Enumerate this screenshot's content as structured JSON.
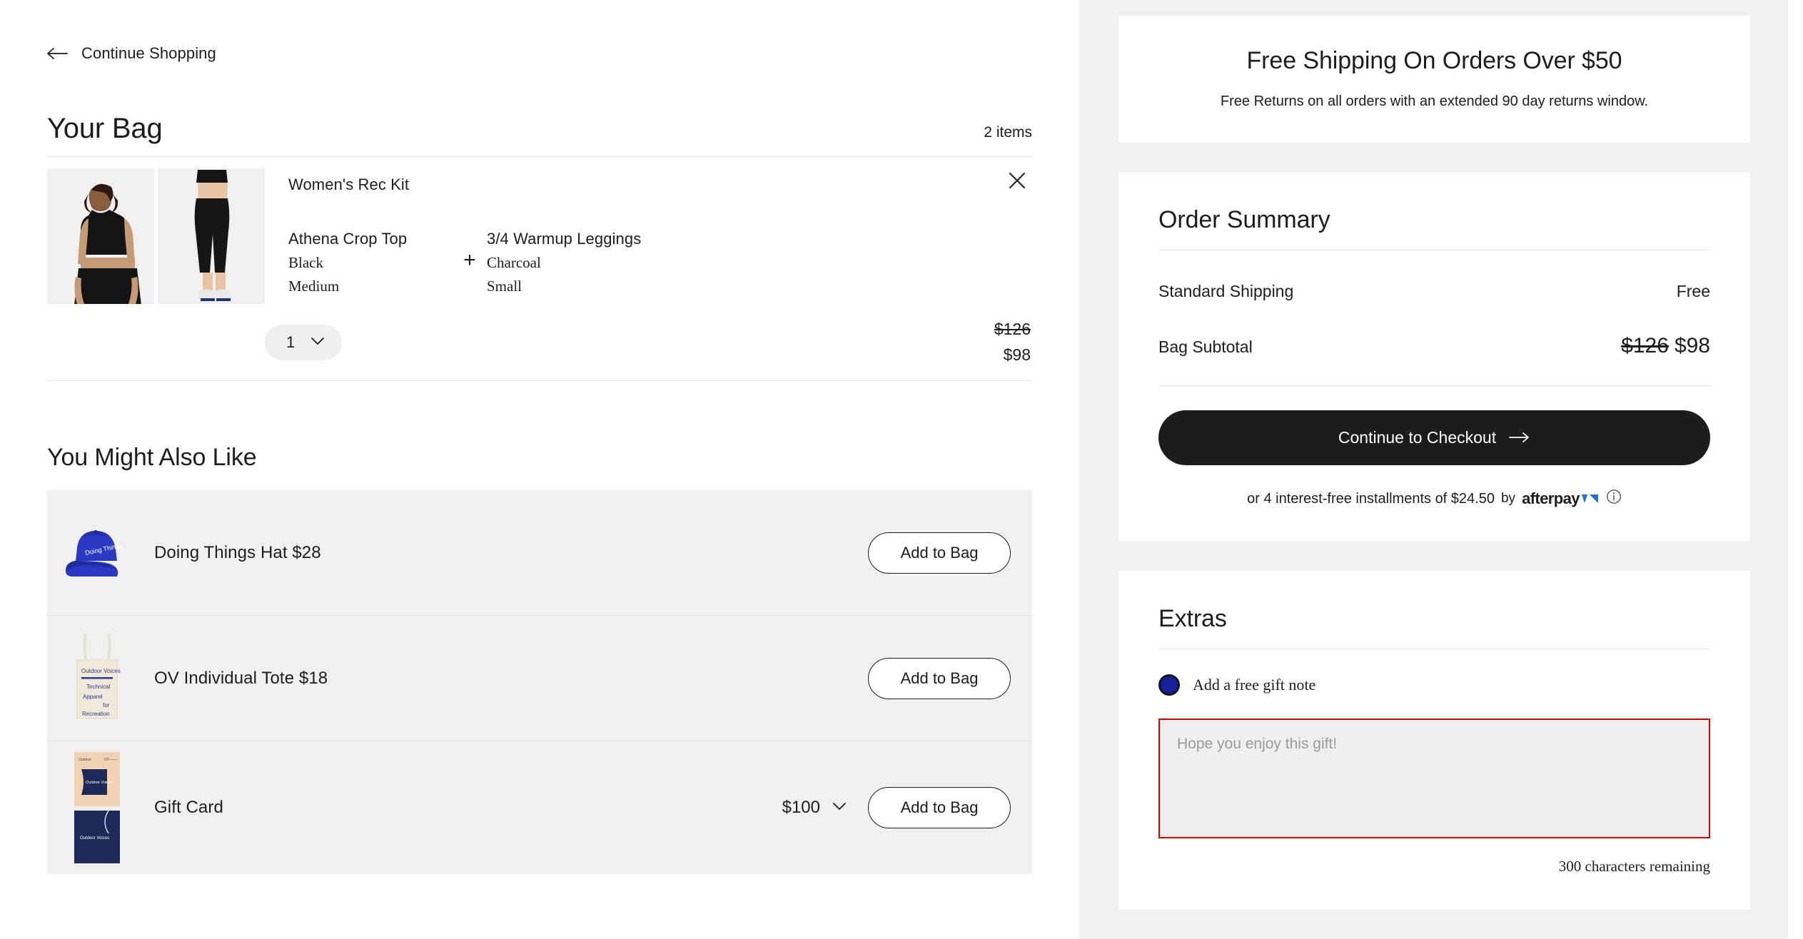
{
  "nav": {
    "back_label": "Continue Shopping",
    "back_icon": "arrow-left-icon"
  },
  "bag": {
    "title": "Your Bag",
    "item_count": "2 items",
    "item": {
      "kit_name": "Women's Rec Kit",
      "remove_icon": "close-icon",
      "components": [
        {
          "name": "Athena Crop Top",
          "color": "Black",
          "size": "Medium"
        },
        {
          "name": "3/4 Warmup Leggings",
          "color": "Charcoal",
          "size": "Small"
        }
      ],
      "joiner": "+",
      "quantity": "1",
      "quantity_caret": "chevron-down-icon",
      "price_was": "$126",
      "price_now": "$98"
    }
  },
  "recommendations": {
    "title": "You Might Also Like",
    "add_label": "Add to Bag",
    "items": [
      {
        "name": "Doing Things Hat $28",
        "image": "blue-cap-image",
        "amount": "",
        "has_amount": false
      },
      {
        "name": "OV Individual Tote $18",
        "image": "canvas-tote-image",
        "amount": "",
        "has_amount": false
      },
      {
        "name": "Gift Card",
        "image": "gift-card-image",
        "amount": "$100",
        "has_amount": true
      }
    ]
  },
  "shipping_banner": {
    "title": "Free Shipping On Orders Over $50",
    "subtitle": "Free Returns on all orders with an extended 90 day returns window."
  },
  "order_summary": {
    "title": "Order Summary",
    "shipping_label": "Standard Shipping",
    "shipping_value": "Free",
    "subtotal_label": "Bag Subtotal",
    "subtotal_was": "$126",
    "subtotal_now": "$98",
    "checkout_label": "Continue to Checkout",
    "checkout_arrow": "arrow-right-icon",
    "installments_text": "or 4 interest-free installments of $24.50",
    "installments_by": "by",
    "afterpay_brand": "afterpay",
    "info_icon": "info-circle-icon"
  },
  "extras": {
    "title": "Extras",
    "gift_note_option": "Add a free gift note",
    "gift_note_placeholder": "Hope you enjoy this gift!",
    "gift_note_value": "",
    "chars_remaining": "300 characters remaining"
  },
  "colors": {
    "accent_dark": "#1d1d1d",
    "panel_grey": "#f0f0f0",
    "error_red": "#cc0000",
    "brand_blue": "#16209b",
    "afterpay_blue": "#1f6fd0"
  }
}
